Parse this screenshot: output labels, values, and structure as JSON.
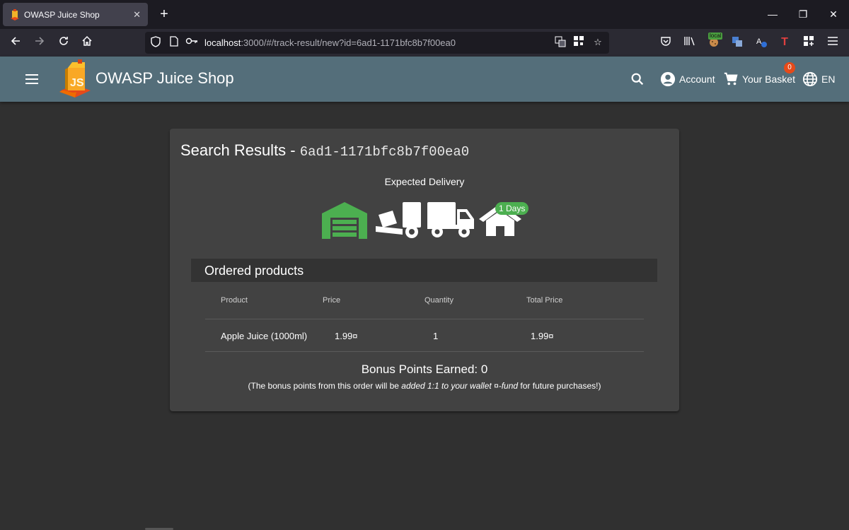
{
  "browser": {
    "tab_title": "OWASP Juice Shop",
    "new_tab": "+",
    "url_host": "localhost",
    "url_rest": ":3000/#/track-result/new?id=6ad1-1171bfc8b7f00ea0",
    "local_badge": "local"
  },
  "header": {
    "title": "OWASP Juice Shop",
    "account_label": "Account",
    "basket_label": "Your Basket",
    "basket_count": "0",
    "language_label": "EN",
    "colors": {
      "toolbar": "#546e7a",
      "badge": "#e64a19"
    }
  },
  "track": {
    "heading": "Search Results - ",
    "order_id": "6ad1-1171bfc8b7f00ea0",
    "expected_delivery_label": "Expected Delivery",
    "days_badge": "1 Days",
    "stages": [
      "warehouse-icon",
      "dolly-icon",
      "truck-icon",
      "home-icon"
    ],
    "active_stage_color": "#4caf50"
  },
  "ordered": {
    "title": "Ordered products",
    "columns": [
      "Product",
      "Price",
      "Quantity",
      "Total Price"
    ],
    "rows": [
      {
        "product": "Apple Juice (1000ml)",
        "price": "1.99¤",
        "quantity": "1",
        "total": "1.99¤"
      }
    ]
  },
  "bonus": {
    "title": "Bonus Points Earned: 0",
    "note_before": "(The bonus points from this order will be ",
    "note_emphasis": "added 1:1 to your wallet ¤-fund",
    "note_after": " for future purchases!)"
  }
}
